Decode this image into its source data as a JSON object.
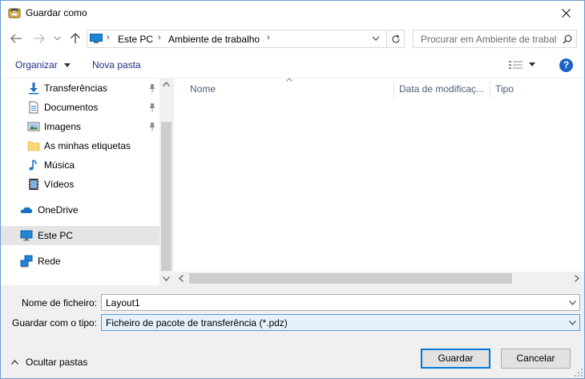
{
  "window": {
    "title": "Guardar como",
    "close_icon": "close-icon"
  },
  "nav": {
    "breadcrumb": [
      "Este PC",
      "Ambiente de trabalho"
    ],
    "search_placeholder": "Procurar em Ambiente de trabalho"
  },
  "toolbar": {
    "organize_label": "Organizar",
    "new_folder_label": "Nova pasta",
    "help_label": "?"
  },
  "sidebar": {
    "items": [
      {
        "label": "Transferências",
        "icon": "download-icon",
        "pinned": true
      },
      {
        "label": "Documentos",
        "icon": "documents-icon",
        "pinned": true
      },
      {
        "label": "Imagens",
        "icon": "pictures-icon",
        "pinned": true
      },
      {
        "label": "As minhas etiquetas",
        "icon": "folder-icon",
        "pinned": false
      },
      {
        "label": "Música",
        "icon": "music-icon",
        "pinned": false
      },
      {
        "label": "Vídeos",
        "icon": "videos-icon",
        "pinned": false
      },
      {
        "label": "OneDrive",
        "icon": "onedrive-icon",
        "pinned": false
      },
      {
        "label": "Este PC",
        "icon": "computer-icon",
        "pinned": false,
        "selected": true
      },
      {
        "label": "Rede",
        "icon": "network-icon",
        "pinned": false
      }
    ]
  },
  "filelist": {
    "columns": [
      "Nome",
      "Data de modificaç...",
      "Tipo"
    ]
  },
  "form": {
    "filename_label": "Nome de ficheiro:",
    "filename_value": "Layout1",
    "filetype_label": "Guardar com o tipo:",
    "filetype_value": "Ficheiro de pacote de transferência (*.pdz)"
  },
  "footer": {
    "hide_folders_label": "Ocultar pastas",
    "save_label": "Guardar",
    "cancel_label": "Cancelar"
  },
  "colors": {
    "accent": "#0078d7",
    "link": "#1e3287",
    "selection": "#e5e5e5"
  }
}
